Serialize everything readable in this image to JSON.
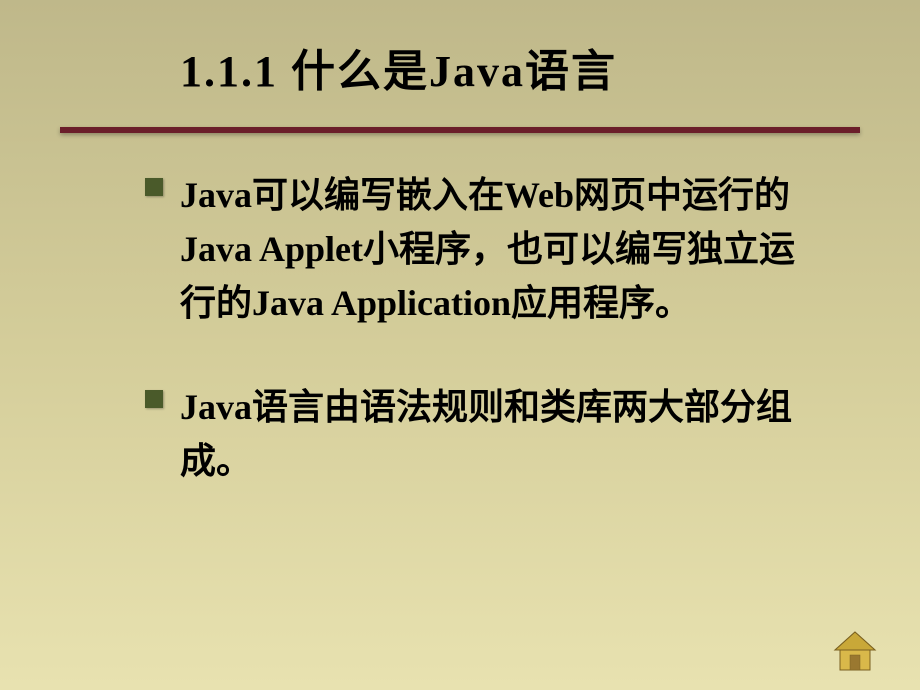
{
  "slide": {
    "title": "1.1.1   什么是Java语言",
    "bullets": [
      "Java可以编写嵌入在Web网页中运行的Java Applet小程序，也可以编写独立运行的Java Application应用程序。",
      "Java语言由语法规则和类库两大部分组成。"
    ]
  },
  "nav": {
    "home_label": "home"
  }
}
